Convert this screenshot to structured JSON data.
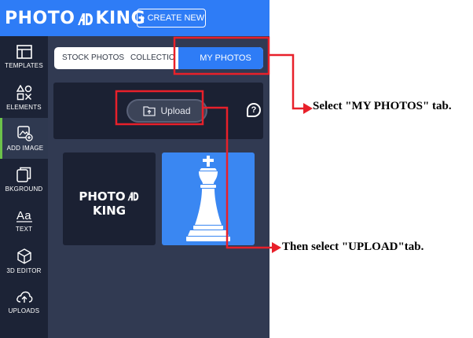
{
  "header": {
    "logo": {
      "part1": "PHOTO",
      "part2": "KING"
    },
    "create_label": "CREATE NEW"
  },
  "sidebar": {
    "items": [
      {
        "label": "TEMPLATES",
        "icon": "templates-icon"
      },
      {
        "label": "ELEMENTS",
        "icon": "elements-icon"
      },
      {
        "label": "ADD IMAGE",
        "icon": "add-image-icon"
      },
      {
        "label": "BKGROUND",
        "icon": "background-icon"
      },
      {
        "label": "TEXT",
        "icon": "text-icon"
      },
      {
        "label": "3D EDITOR",
        "icon": "3d-editor-icon"
      },
      {
        "label": "UPLOADS",
        "icon": "uploads-icon"
      }
    ],
    "active": "ADD IMAGE"
  },
  "panel": {
    "tabs": [
      {
        "label": "STOCK PHOTOS"
      },
      {
        "label": "COLLECTIONS"
      },
      {
        "label": "MY PHOTOS"
      }
    ],
    "active_tab": "MY PHOTOS",
    "upload_label": "Upload",
    "help_symbol": "?"
  },
  "thumbnails": [
    {
      "type": "logo",
      "text_part1": "PHOTO",
      "text_part2": "KING"
    },
    {
      "type": "chess-king-image"
    }
  ],
  "annotations": {
    "step1": "Select \"MY PHOTOS\" tab.",
    "step2": "Then select \"UPLOAD\"tab."
  },
  "colors": {
    "brand_blue": "#2e7cf6",
    "sidebar_bg": "#1c2336",
    "panel_bg": "#313a52",
    "active_accent": "#6cc24a",
    "annotation_red": "#e8202a"
  }
}
